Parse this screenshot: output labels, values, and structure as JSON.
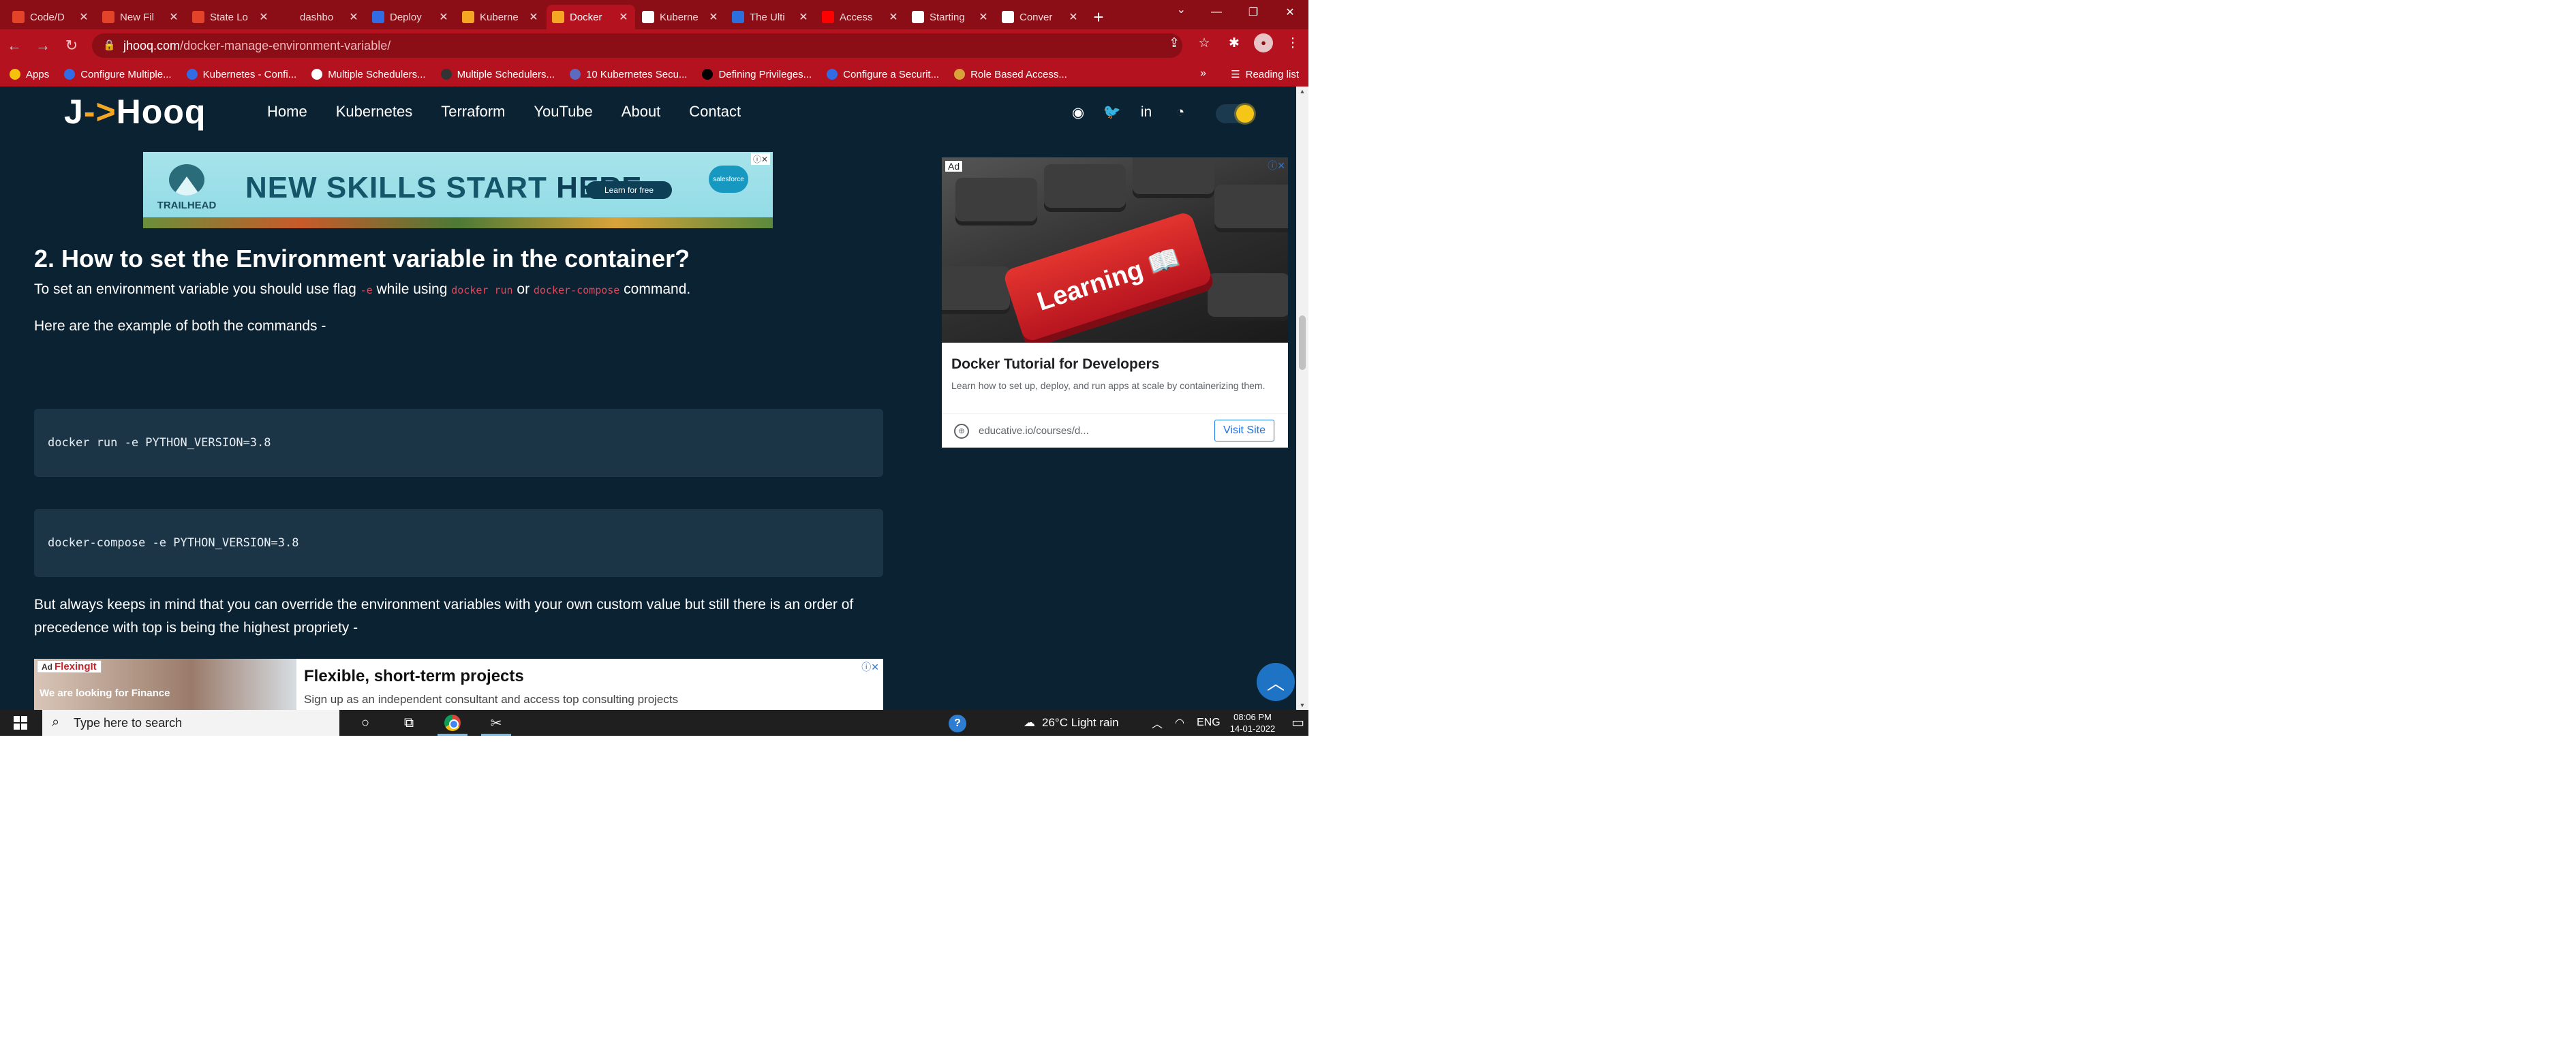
{
  "browser": {
    "tabs": [
      {
        "label": "Code/D",
        "favicon": "gitlab-icon",
        "color": "#e24329"
      },
      {
        "label": "New Fil",
        "favicon": "gitlab-icon",
        "color": "#e24329"
      },
      {
        "label": "State Lo",
        "favicon": "gitlab-icon",
        "color": "#e24329"
      },
      {
        "label": "dashbo",
        "favicon": "dashboard-icon",
        "color": "#8b0d16"
      },
      {
        "label": "Deploy",
        "favicon": "kubernetes-icon",
        "color": "#326ce5"
      },
      {
        "label": "Kuberne",
        "favicon": "jhooq-icon",
        "color": "#f5a623"
      },
      {
        "label": "Docker",
        "favicon": "jhooq-icon",
        "color": "#f5a623",
        "active": true
      },
      {
        "label": "Kuberne",
        "favicon": "globe-icon",
        "color": "#ffffff"
      },
      {
        "label": "The Ulti",
        "favicon": "info-icon",
        "color": "#2a6fdb"
      },
      {
        "label": "Access",
        "favicon": "youtube-icon",
        "color": "#ff0000"
      },
      {
        "label": "Starting",
        "favicon": "starting-icon",
        "color": "#ffffff"
      },
      {
        "label": "Conver",
        "favicon": "cc-icon",
        "color": "#ffffff"
      }
    ],
    "url_host": "jhooq.com",
    "url_path": "/docker-manage-environment-variable/",
    "bookmarks": [
      {
        "label": "Apps",
        "icon": "apps-grid-icon"
      },
      {
        "label": "Configure Multiple...",
        "icon": "kubernetes-icon"
      },
      {
        "label": "Kubernetes - Confi...",
        "icon": "kubernetes-icon"
      },
      {
        "label": "Multiple Schedulers...",
        "icon": "notion-icon"
      },
      {
        "label": "Multiple Schedulers...",
        "icon": "github-icon"
      },
      {
        "label": "10 Kubernetes Secu...",
        "icon": "security-icon"
      },
      {
        "label": "Defining Privileges...",
        "icon": "medium-icon"
      },
      {
        "label": "Configure a Securit...",
        "icon": "kubernetes-icon"
      },
      {
        "label": "Role Based Access...",
        "icon": "role-icon"
      }
    ],
    "bookmarks_more": "»",
    "reading_list": "Reading list"
  },
  "site": {
    "logo_prefix": "J",
    "logo_arrow": "->",
    "logo_suffix": "Hooq",
    "menu": [
      "Home",
      "Kubernetes",
      "Terraform",
      "YouTube",
      "About",
      "Contact"
    ]
  },
  "top_ad": {
    "brand": "TRAILHEAD",
    "headline_a": "NEW SKILLS START ",
    "headline_b": "HERE.",
    "cta": "Learn for free",
    "badge": "salesforce",
    "adchoice": "ⓘ✕"
  },
  "article": {
    "section_title": "2. How to set the Environment variable in the container?",
    "para1_a": "To set an environment variable you should use flag ",
    "para1_flag": "-e",
    "para1_b": " while using ",
    "para1_cmd1": "docker run",
    "para1_c": " or ",
    "para1_cmd2": "docker-compose",
    "para1_d": " command.",
    "para2": "Here are the example of both the commands -",
    "code1": "docker run -e PYTHON_VERSION=3.8",
    "code2": "docker-compose -e PYTHON_VERSION=3.8",
    "para3": "But always keeps in mind that you can override the environment variables with your own custom value but still there is an order of precedence with top is being the highest propriety -"
  },
  "bottom_ad": {
    "ad_label": "Ad",
    "brand": "FlexingIt",
    "image_text": "We are looking for Finance",
    "headline": "Flexible, short-term projects",
    "sub": "Sign up as an independent consultant and access top consulting projects",
    "close": "ⓘ✕"
  },
  "side_ad": {
    "ad_label": "Ad",
    "close": "ⓘ✕",
    "key_text": "Learning",
    "title": "Docker Tutorial for Developers",
    "desc": "Learn how to set up, deploy, and run apps at scale by containerizing them.",
    "url": "educative.io/courses/d...",
    "visit": "Visit Site"
  },
  "taskbar": {
    "search_placeholder": "Type here to search",
    "weather": "26°C  Light rain",
    "lang": "ENG",
    "time": "08:06 PM",
    "date": "14-01-2022"
  },
  "colors": {
    "chrome_dark": "#8b0d16",
    "chrome_light": "#b3121e",
    "page_bg": "#0b2233",
    "code_bg": "#1b3547",
    "accent": "#f5a623",
    "inline_code": "#e0475a"
  }
}
